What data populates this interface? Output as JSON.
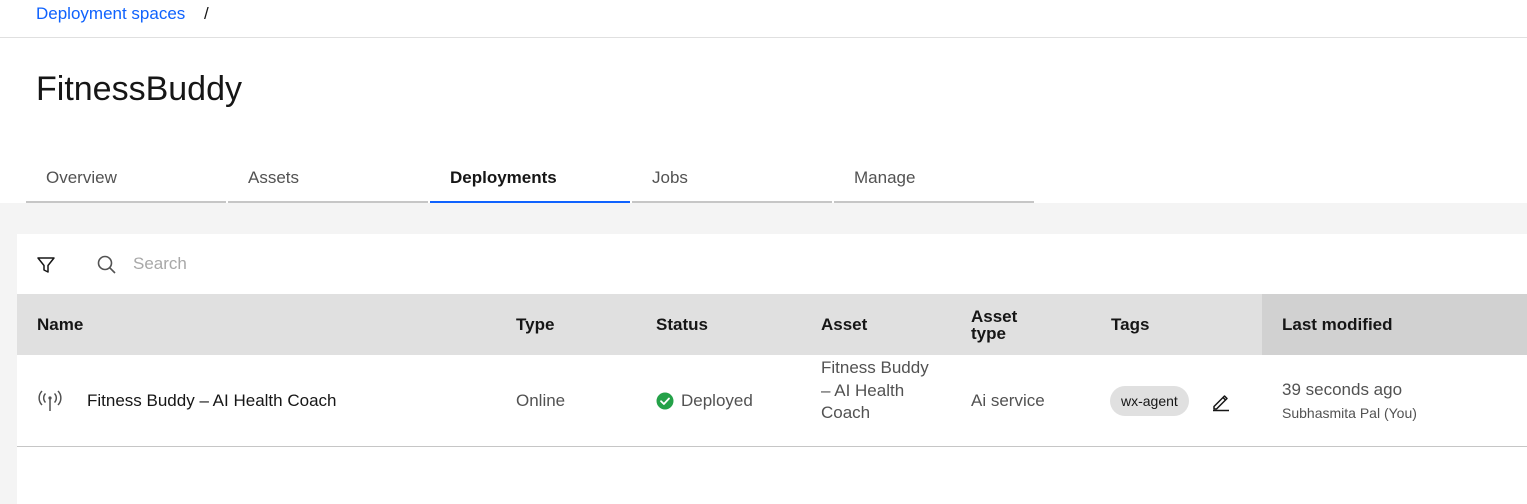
{
  "breadcrumb": {
    "link": "Deployment spaces",
    "separator": "/"
  },
  "page": {
    "title": "FitnessBuddy"
  },
  "tabs": [
    {
      "label": "Overview",
      "active": false
    },
    {
      "label": "Assets",
      "active": false
    },
    {
      "label": "Deployments",
      "active": true
    },
    {
      "label": "Jobs",
      "active": false
    },
    {
      "label": "Manage",
      "active": false
    }
  ],
  "toolbar": {
    "filter_icon": "filter-icon",
    "search_icon": "search-icon",
    "search_placeholder": "Search",
    "search_value": ""
  },
  "table": {
    "headers": {
      "name": "Name",
      "type": "Type",
      "status": "Status",
      "asset": "Asset",
      "asset_type_line1": "Asset",
      "asset_type_line2": "type",
      "tags": "Tags",
      "last_modified": "Last modified"
    },
    "rows": [
      {
        "icon": "online-deployment-icon",
        "name": "Fitness Buddy – AI Health Coach",
        "type": "Online",
        "status": "Deployed",
        "status_color": "#24a148",
        "asset": "Fitness Buddy – AI Health Coach",
        "asset_type": "Ai service",
        "tag": "wx-agent",
        "modified": "39 seconds ago",
        "modified_by": "Subhasmita Pal (You)"
      }
    ]
  },
  "colors": {
    "accent": "#0f62fe",
    "header_bg": "#e0e0e0",
    "sorted_header_bg": "#d1d1d1",
    "page_bg": "#f4f4f4"
  }
}
